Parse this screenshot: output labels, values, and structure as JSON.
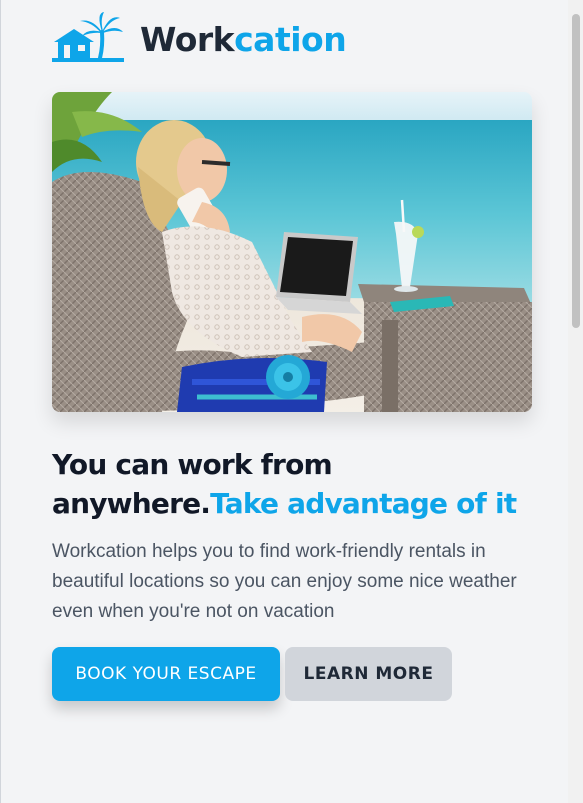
{
  "brand": {
    "name_part1": "Work",
    "name_part2": "cation",
    "icon": "beach-house-palm-icon",
    "colors": {
      "dark": "#1f2937",
      "accent": "#0ea5e9"
    }
  },
  "hero_image": {
    "icon": "woman-working-on-beach-photo"
  },
  "headline": {
    "line1": "You can work from anywhere.",
    "accent": "Take advantage of it"
  },
  "description": "Workcation helps you to find work-friendly rentals in beautiful locations so you can enjoy some nice weather even when you're not on vacation",
  "actions": {
    "primary_label": "BOOK YOUR ESCAPE",
    "secondary_label": "LEARN MORE"
  },
  "colors": {
    "background": "#f3f4f6",
    "primary_button": "#0ea5e9",
    "secondary_button": "#d1d5db",
    "heading": "#111827",
    "body_text": "#4b5563"
  }
}
